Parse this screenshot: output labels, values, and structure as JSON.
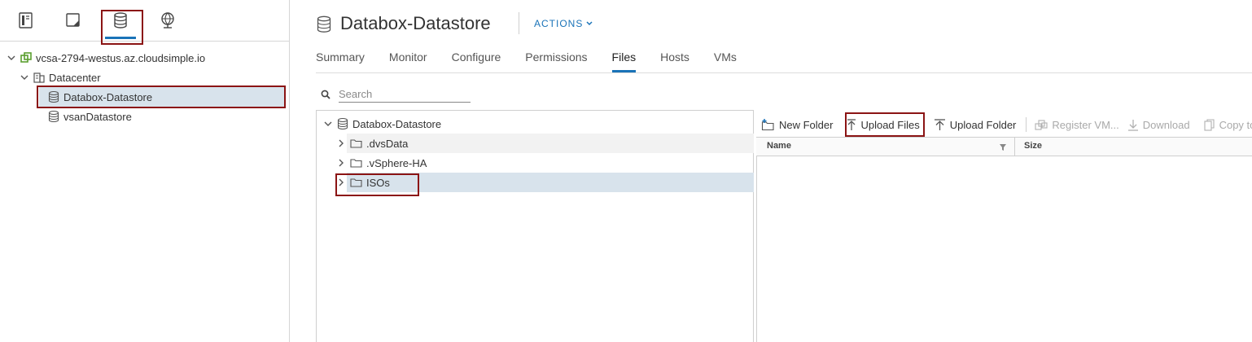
{
  "nav": {
    "icons": [
      "hosts-clusters-icon",
      "vms-templates-icon",
      "storage-icon",
      "networking-icon"
    ],
    "active": "storage-icon"
  },
  "inventory": {
    "vcenter": "vcsa-2794-westus.az.cloudsimple.io",
    "datacenter": "Datacenter",
    "datastores": [
      "Databox-Datastore",
      "vsanDatastore"
    ],
    "selected": "Databox-Datastore"
  },
  "header": {
    "title": "Databox-Datastore",
    "actions_label": "ACTIONS"
  },
  "tabs": [
    "Summary",
    "Monitor",
    "Configure",
    "Permissions",
    "Files",
    "Hosts",
    "VMs"
  ],
  "active_tab": "Files",
  "search": {
    "placeholder": "Search",
    "value": ""
  },
  "file_tree": {
    "root": "Databox-Datastore",
    "folders": [
      ".dvsData",
      ".vSphere-HA",
      "ISOs"
    ],
    "selected": "ISOs"
  },
  "toolbar": {
    "new_folder": "New Folder",
    "upload_files": "Upload Files",
    "upload_folder": "Upload Folder",
    "register_vm": "Register VM...",
    "download": "Download",
    "copy_to": "Copy to"
  },
  "grid": {
    "columns": [
      "Name",
      "Size"
    ]
  },
  "colors": {
    "accent": "#1a73b8",
    "highlight_box": "#8b1414",
    "selection": "#d8e3ec"
  }
}
